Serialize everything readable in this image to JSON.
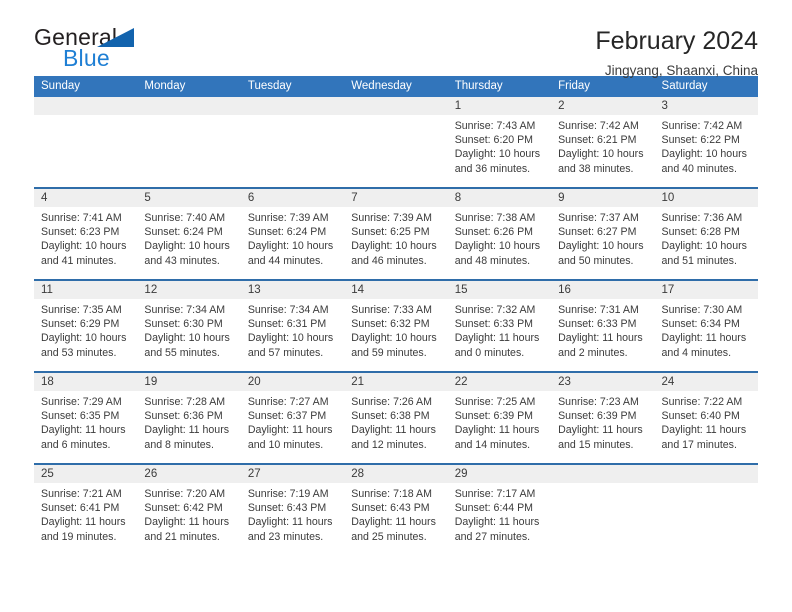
{
  "brand": {
    "name_part1": "General",
    "name_part2": "Blue",
    "triangle_color": "#1263ad",
    "blue_color": "#1f7fd4"
  },
  "header": {
    "title": "February 2024",
    "location": "Jingyang, Shaanxi, China"
  },
  "theme": {
    "header_bar": "#3275bb",
    "row_divider": "#2f6da9",
    "day_head_bg": "#efefef"
  },
  "weekdays": [
    "Sunday",
    "Monday",
    "Tuesday",
    "Wednesday",
    "Thursday",
    "Friday",
    "Saturday"
  ],
  "weeks": [
    [
      {
        "day": "",
        "lines": []
      },
      {
        "day": "",
        "lines": []
      },
      {
        "day": "",
        "lines": []
      },
      {
        "day": "",
        "lines": []
      },
      {
        "day": "1",
        "lines": [
          "Sunrise: 7:43 AM",
          "Sunset: 6:20 PM",
          "Daylight: 10 hours",
          "and 36 minutes."
        ]
      },
      {
        "day": "2",
        "lines": [
          "Sunrise: 7:42 AM",
          "Sunset: 6:21 PM",
          "Daylight: 10 hours",
          "and 38 minutes."
        ]
      },
      {
        "day": "3",
        "lines": [
          "Sunrise: 7:42 AM",
          "Sunset: 6:22 PM",
          "Daylight: 10 hours",
          "and 40 minutes."
        ]
      }
    ],
    [
      {
        "day": "4",
        "lines": [
          "Sunrise: 7:41 AM",
          "Sunset: 6:23 PM",
          "Daylight: 10 hours",
          "and 41 minutes."
        ]
      },
      {
        "day": "5",
        "lines": [
          "Sunrise: 7:40 AM",
          "Sunset: 6:24 PM",
          "Daylight: 10 hours",
          "and 43 minutes."
        ]
      },
      {
        "day": "6",
        "lines": [
          "Sunrise: 7:39 AM",
          "Sunset: 6:24 PM",
          "Daylight: 10 hours",
          "and 44 minutes."
        ]
      },
      {
        "day": "7",
        "lines": [
          "Sunrise: 7:39 AM",
          "Sunset: 6:25 PM",
          "Daylight: 10 hours",
          "and 46 minutes."
        ]
      },
      {
        "day": "8",
        "lines": [
          "Sunrise: 7:38 AM",
          "Sunset: 6:26 PM",
          "Daylight: 10 hours",
          "and 48 minutes."
        ]
      },
      {
        "day": "9",
        "lines": [
          "Sunrise: 7:37 AM",
          "Sunset: 6:27 PM",
          "Daylight: 10 hours",
          "and 50 minutes."
        ]
      },
      {
        "day": "10",
        "lines": [
          "Sunrise: 7:36 AM",
          "Sunset: 6:28 PM",
          "Daylight: 10 hours",
          "and 51 minutes."
        ]
      }
    ],
    [
      {
        "day": "11",
        "lines": [
          "Sunrise: 7:35 AM",
          "Sunset: 6:29 PM",
          "Daylight: 10 hours",
          "and 53 minutes."
        ]
      },
      {
        "day": "12",
        "lines": [
          "Sunrise: 7:34 AM",
          "Sunset: 6:30 PM",
          "Daylight: 10 hours",
          "and 55 minutes."
        ]
      },
      {
        "day": "13",
        "lines": [
          "Sunrise: 7:34 AM",
          "Sunset: 6:31 PM",
          "Daylight: 10 hours",
          "and 57 minutes."
        ]
      },
      {
        "day": "14",
        "lines": [
          "Sunrise: 7:33 AM",
          "Sunset: 6:32 PM",
          "Daylight: 10 hours",
          "and 59 minutes."
        ]
      },
      {
        "day": "15",
        "lines": [
          "Sunrise: 7:32 AM",
          "Sunset: 6:33 PM",
          "Daylight: 11 hours",
          "and 0 minutes."
        ]
      },
      {
        "day": "16",
        "lines": [
          "Sunrise: 7:31 AM",
          "Sunset: 6:33 PM",
          "Daylight: 11 hours",
          "and 2 minutes."
        ]
      },
      {
        "day": "17",
        "lines": [
          "Sunrise: 7:30 AM",
          "Sunset: 6:34 PM",
          "Daylight: 11 hours",
          "and 4 minutes."
        ]
      }
    ],
    [
      {
        "day": "18",
        "lines": [
          "Sunrise: 7:29 AM",
          "Sunset: 6:35 PM",
          "Daylight: 11 hours",
          "and 6 minutes."
        ]
      },
      {
        "day": "19",
        "lines": [
          "Sunrise: 7:28 AM",
          "Sunset: 6:36 PM",
          "Daylight: 11 hours",
          "and 8 minutes."
        ]
      },
      {
        "day": "20",
        "lines": [
          "Sunrise: 7:27 AM",
          "Sunset: 6:37 PM",
          "Daylight: 11 hours",
          "and 10 minutes."
        ]
      },
      {
        "day": "21",
        "lines": [
          "Sunrise: 7:26 AM",
          "Sunset: 6:38 PM",
          "Daylight: 11 hours",
          "and 12 minutes."
        ]
      },
      {
        "day": "22",
        "lines": [
          "Sunrise: 7:25 AM",
          "Sunset: 6:39 PM",
          "Daylight: 11 hours",
          "and 14 minutes."
        ]
      },
      {
        "day": "23",
        "lines": [
          "Sunrise: 7:23 AM",
          "Sunset: 6:39 PM",
          "Daylight: 11 hours",
          "and 15 minutes."
        ]
      },
      {
        "day": "24",
        "lines": [
          "Sunrise: 7:22 AM",
          "Sunset: 6:40 PM",
          "Daylight: 11 hours",
          "and 17 minutes."
        ]
      }
    ],
    [
      {
        "day": "25",
        "lines": [
          "Sunrise: 7:21 AM",
          "Sunset: 6:41 PM",
          "Daylight: 11 hours",
          "and 19 minutes."
        ]
      },
      {
        "day": "26",
        "lines": [
          "Sunrise: 7:20 AM",
          "Sunset: 6:42 PM",
          "Daylight: 11 hours",
          "and 21 minutes."
        ]
      },
      {
        "day": "27",
        "lines": [
          "Sunrise: 7:19 AM",
          "Sunset: 6:43 PM",
          "Daylight: 11 hours",
          "and 23 minutes."
        ]
      },
      {
        "day": "28",
        "lines": [
          "Sunrise: 7:18 AM",
          "Sunset: 6:43 PM",
          "Daylight: 11 hours",
          "and 25 minutes."
        ]
      },
      {
        "day": "29",
        "lines": [
          "Sunrise: 7:17 AM",
          "Sunset: 6:44 PM",
          "Daylight: 11 hours",
          "and 27 minutes."
        ]
      },
      {
        "day": "",
        "lines": []
      },
      {
        "day": "",
        "lines": []
      }
    ]
  ]
}
